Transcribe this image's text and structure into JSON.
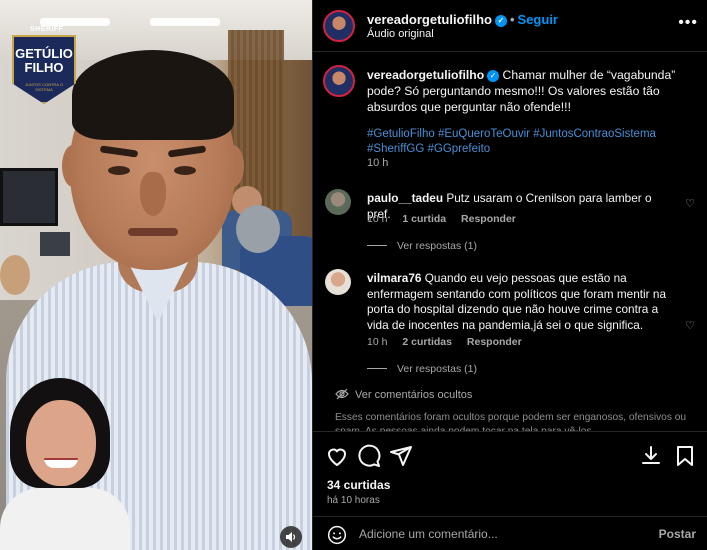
{
  "media": {
    "badge": {
      "top": "SHERIFF",
      "line1": "GETÚLIO",
      "line2": "FILHO",
      "sub": "JUNTOS CONTRA O SISTEMA"
    },
    "mute_icon": "speaker-icon"
  },
  "header": {
    "username": "vereadorgetuliofilho",
    "separator": "•",
    "follow_label": "Seguir",
    "audio_label": "Áudio original",
    "more_icon": "more-options-icon"
  },
  "post": {
    "username": "vereadorgetuliofilho",
    "caption": "Chamar mulher de “vagabunda” pode? Só perguntando mesmo!!! Os valores estão tão absurdos que perguntar não ofende!!!",
    "hashtags": "#GetulioFilho #EuQueroTeOuvir #JuntosContraoSistema #SheriffGG #GGprefeito",
    "time": "10 h"
  },
  "comments": [
    {
      "username": "paulo__tadeu",
      "text": "Putz usaram o Crenilson para lamber o pref.",
      "time": "10 h",
      "likes": "1 curtida",
      "reply_label": "Responder",
      "view_replies": "Ver respostas (1)"
    },
    {
      "username": "vilmara76",
      "text": "Quando eu vejo pessoas que estão na enfermagem sentando com políticos que foram mentir na porta do hospital dizendo que não houve crime contra a vida de inocentes na pandemia,já sei o que significa.",
      "time": "10 h",
      "likes": "2 curtidas",
      "reply_label": "Responder",
      "view_replies": "Ver respostas (1)"
    }
  ],
  "hidden": {
    "label": "Ver comentários ocultos",
    "note": "Esses comentários foram ocultos porque podem ser enganosos, ofensivos ou spam. As pessoas ainda podem tocar na tela para vê-los."
  },
  "footer": {
    "likes": "34 curtidas",
    "ago": "há 10 horas",
    "icons": [
      "heart-icon",
      "comment-icon",
      "share-icon",
      "download-icon",
      "bookmark-icon"
    ]
  },
  "composer": {
    "placeholder": "Adicione um comentário...",
    "post_label": "Postar"
  },
  "colors": {
    "accent": "#0095f6",
    "hashtag": "#4a8fd6",
    "muted": "#a8a8a8",
    "background": "#000000"
  }
}
